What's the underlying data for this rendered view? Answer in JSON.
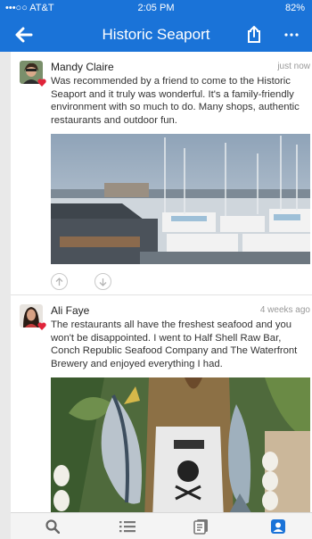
{
  "status": {
    "carrier": "•••○○ AT&T",
    "time": "2:05 PM",
    "battery": "82%"
  },
  "header": {
    "title": "Historic Seaport"
  },
  "posts": [
    {
      "author": "Mandy Claire",
      "time": "just now",
      "text": "Was recommended by a friend to come to the Historic Seaport and it truly was wonderful. It's a family-friendly environment with so much to do. Many shops, authentic restaurants and outdoor fun."
    },
    {
      "author": "Ali Faye",
      "time": "4 weeks ago",
      "text": "The restaurants all have the freshest seafood and you won't be disappointed. I went to Half Shell Raw Bar, Conch Republic Seafood Company and The Waterfront Brewery and enjoyed everything I had."
    }
  ],
  "colors": {
    "brand": "#1a73d8",
    "heart": "#e0243a"
  },
  "icons": {
    "tabs": [
      "search-icon",
      "list-icon",
      "notes-icon",
      "profile-icon"
    ]
  }
}
